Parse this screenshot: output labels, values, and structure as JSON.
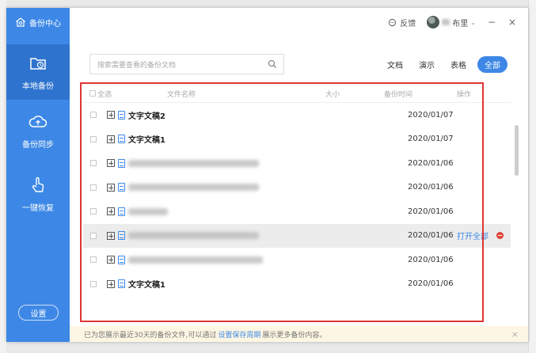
{
  "app": {
    "title": "备份中心"
  },
  "sidebar": {
    "items": [
      {
        "label": "本地备份",
        "icon": "folder-clock-icon",
        "active": true
      },
      {
        "label": "备份同步",
        "icon": "cloud-upload-icon",
        "active": false
      },
      {
        "label": "一键恢复",
        "icon": "hand-tap-icon",
        "active": false
      }
    ],
    "settings_label": "设置"
  },
  "titlebar": {
    "feedback_label": "反馈",
    "user_name_suffix": "布里",
    "minimize": "−",
    "close": "×"
  },
  "search": {
    "placeholder": "搜索需要查看的备份文档"
  },
  "filters": {
    "doc": "文档",
    "slides": "演示",
    "sheets": "表格",
    "all": "全部"
  },
  "table": {
    "headers": {
      "select_all": "全选",
      "name": "文件名称",
      "size": "大小",
      "time": "备份时间",
      "action": "操作"
    },
    "rows": [
      {
        "name": "文字文稿2",
        "date": "2020/01/07",
        "blurred": false
      },
      {
        "name": "文字文稿1",
        "date": "2020/01/07",
        "blurred": false
      },
      {
        "name": "",
        "date": "2020/01/06",
        "blurred": true
      },
      {
        "name": "",
        "date": "2020/01/06",
        "blurred": true
      },
      {
        "name": "",
        "date": "2020/01/06",
        "blurred": true
      },
      {
        "name": "",
        "date": "2020/01/06",
        "blurred": true,
        "highlighted": true,
        "action": "打开全部"
      },
      {
        "name": "",
        "date": "2020/01/06",
        "blurred": true
      },
      {
        "name": "文字文稿1",
        "date": "2020/01/06",
        "blurred": false
      }
    ]
  },
  "footer": {
    "text_before": "已为您展示最近30天的备份文件,可以通过",
    "link": "设置保存周期",
    "text_after": "展示更多备份内容。"
  },
  "colors": {
    "accent": "#3d88e6",
    "sidebar_active": "#2e74cf",
    "highlight": "#e03535"
  }
}
